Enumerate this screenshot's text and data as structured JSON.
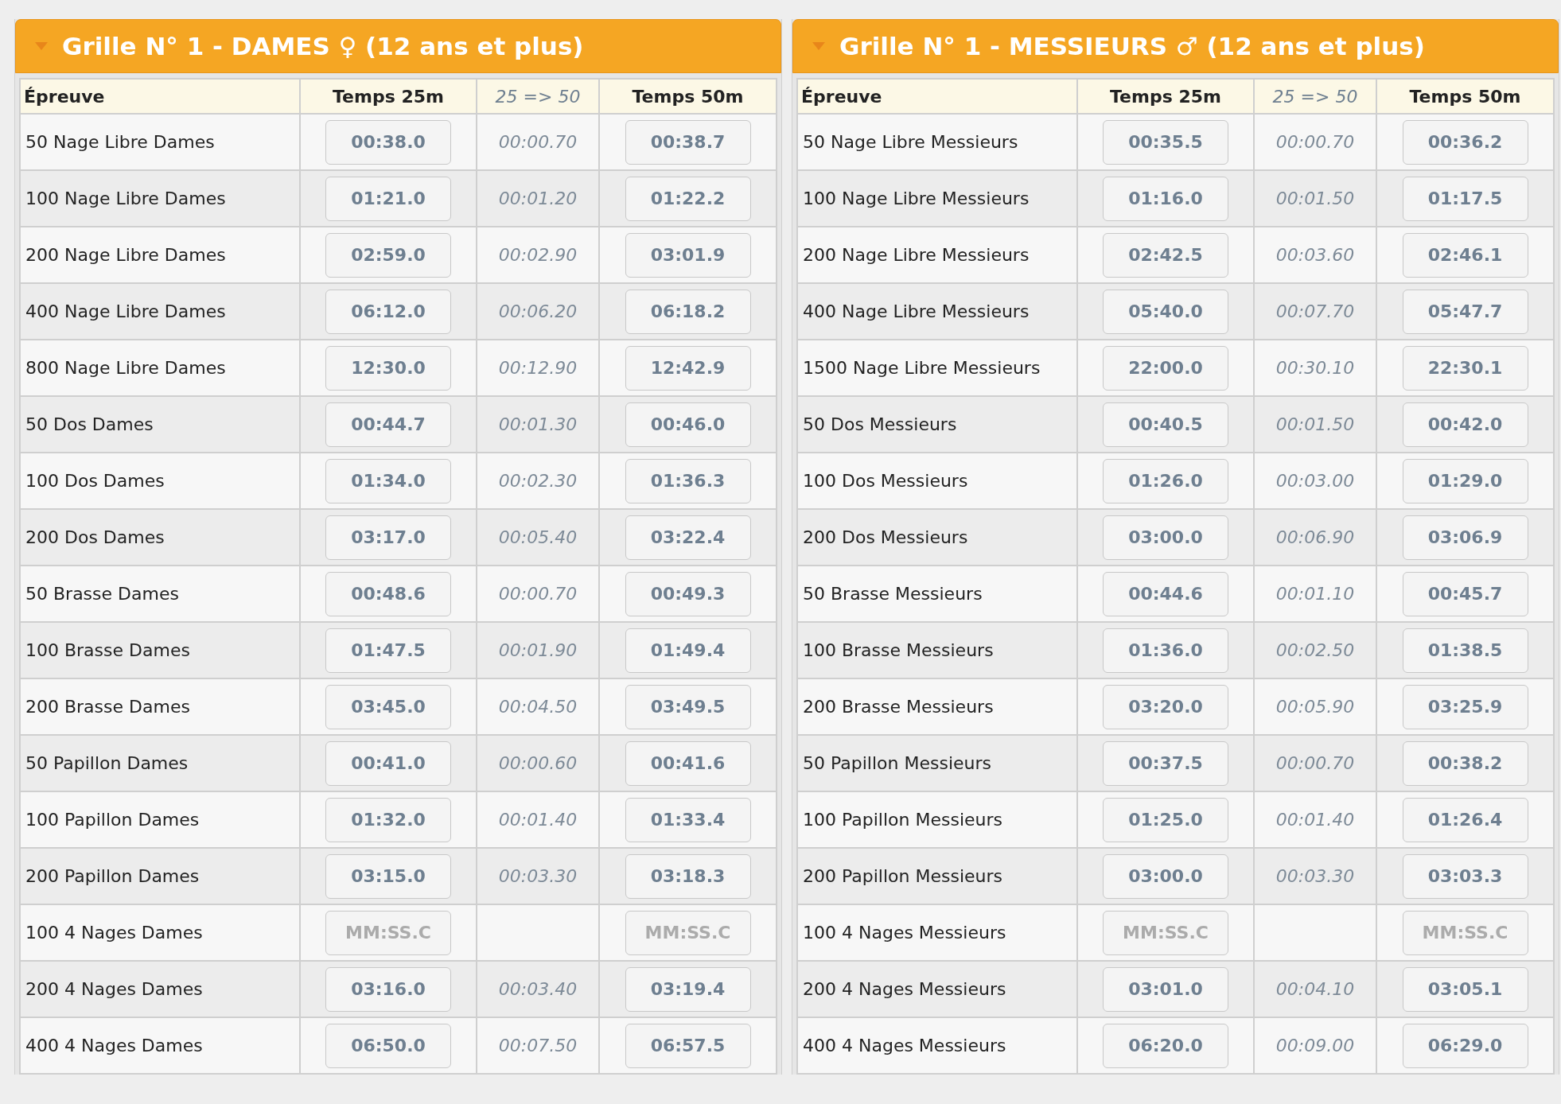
{
  "panels": [
    {
      "title": "Grille N° 1 - DAMES ♀ (12 ans et plus)",
      "columns": [
        "Épreuve",
        "Temps 25m",
        "25 => 50",
        "Temps 50m"
      ],
      "rows": [
        {
          "event": "50 Nage Libre Dames",
          "time_25m": {
            "value": "00:38.0"
          },
          "diff": "00:00.70",
          "time_50m": {
            "value": "00:38.7"
          }
        },
        {
          "event": "100 Nage Libre Dames",
          "time_25m": {
            "value": "01:21.0"
          },
          "diff": "00:01.20",
          "time_50m": {
            "value": "01:22.2"
          }
        },
        {
          "event": "200 Nage Libre Dames",
          "time_25m": {
            "value": "02:59.0"
          },
          "diff": "00:02.90",
          "time_50m": {
            "value": "03:01.9"
          }
        },
        {
          "event": "400 Nage Libre Dames",
          "time_25m": {
            "value": "06:12.0"
          },
          "diff": "00:06.20",
          "time_50m": {
            "value": "06:18.2"
          }
        },
        {
          "event": "800 Nage Libre Dames",
          "time_25m": {
            "value": "12:30.0"
          },
          "diff": "00:12.90",
          "time_50m": {
            "value": "12:42.9"
          }
        },
        {
          "event": "50 Dos Dames",
          "time_25m": {
            "value": "00:44.7"
          },
          "diff": "00:01.30",
          "time_50m": {
            "value": "00:46.0"
          }
        },
        {
          "event": "100 Dos Dames",
          "time_25m": {
            "value": "01:34.0"
          },
          "diff": "00:02.30",
          "time_50m": {
            "value": "01:36.3"
          }
        },
        {
          "event": "200 Dos Dames",
          "time_25m": {
            "value": "03:17.0"
          },
          "diff": "00:05.40",
          "time_50m": {
            "value": "03:22.4"
          }
        },
        {
          "event": "50 Brasse Dames",
          "time_25m": {
            "value": "00:48.6"
          },
          "diff": "00:00.70",
          "time_50m": {
            "value": "00:49.3"
          }
        },
        {
          "event": "100 Brasse Dames",
          "time_25m": {
            "value": "01:47.5"
          },
          "diff": "00:01.90",
          "time_50m": {
            "value": "01:49.4"
          }
        },
        {
          "event": "200 Brasse Dames",
          "time_25m": {
            "value": "03:45.0"
          },
          "diff": "00:04.50",
          "time_50m": {
            "value": "03:49.5"
          }
        },
        {
          "event": "50 Papillon Dames",
          "time_25m": {
            "value": "00:41.0"
          },
          "diff": "00:00.60",
          "time_50m": {
            "value": "00:41.6"
          }
        },
        {
          "event": "100 Papillon Dames",
          "time_25m": {
            "value": "01:32.0"
          },
          "diff": "00:01.40",
          "time_50m": {
            "value": "01:33.4"
          }
        },
        {
          "event": "200 Papillon Dames",
          "time_25m": {
            "value": "03:15.0"
          },
          "diff": "00:03.30",
          "time_50m": {
            "value": "03:18.3"
          }
        },
        {
          "event": "100 4 Nages Dames",
          "time_25m": {
            "placeholder": "MM:SS.C"
          },
          "time_50m": {
            "placeholder": "MM:SS.C"
          }
        },
        {
          "event": "200 4 Nages Dames",
          "time_25m": {
            "value": "03:16.0"
          },
          "diff": "00:03.40",
          "time_50m": {
            "value": "03:19.4"
          }
        },
        {
          "event": "400 4 Nages Dames",
          "time_25m": {
            "value": "06:50.0"
          },
          "diff": "00:07.50",
          "time_50m": {
            "value": "06:57.5"
          }
        }
      ]
    },
    {
      "title": "Grille N° 1 - MESSIEURS ♂ (12 ans et plus)",
      "columns": [
        "Épreuve",
        "Temps 25m",
        "25 => 50",
        "Temps 50m"
      ],
      "rows": [
        {
          "event": "50 Nage Libre Messieurs",
          "time_25m": {
            "value": "00:35.5"
          },
          "diff": "00:00.70",
          "time_50m": {
            "value": "00:36.2"
          }
        },
        {
          "event": "100 Nage Libre Messieurs",
          "time_25m": {
            "value": "01:16.0"
          },
          "diff": "00:01.50",
          "time_50m": {
            "value": "01:17.5"
          }
        },
        {
          "event": "200 Nage Libre Messieurs",
          "time_25m": {
            "value": "02:42.5"
          },
          "diff": "00:03.60",
          "time_50m": {
            "value": "02:46.1"
          }
        },
        {
          "event": "400 Nage Libre Messieurs",
          "time_25m": {
            "value": "05:40.0"
          },
          "diff": "00:07.70",
          "time_50m": {
            "value": "05:47.7"
          }
        },
        {
          "event": "1500 Nage Libre Messieurs",
          "time_25m": {
            "value": "22:00.0"
          },
          "diff": "00:30.10",
          "time_50m": {
            "value": "22:30.1"
          }
        },
        {
          "event": "50 Dos Messieurs",
          "time_25m": {
            "value": "00:40.5"
          },
          "diff": "00:01.50",
          "time_50m": {
            "value": "00:42.0"
          }
        },
        {
          "event": "100 Dos Messieurs",
          "time_25m": {
            "value": "01:26.0"
          },
          "diff": "00:03.00",
          "time_50m": {
            "value": "01:29.0"
          }
        },
        {
          "event": "200 Dos Messieurs",
          "time_25m": {
            "value": "03:00.0"
          },
          "diff": "00:06.90",
          "time_50m": {
            "value": "03:06.9"
          }
        },
        {
          "event": "50 Brasse Messieurs",
          "time_25m": {
            "value": "00:44.6"
          },
          "diff": "00:01.10",
          "time_50m": {
            "value": "00:45.7"
          }
        },
        {
          "event": "100 Brasse Messieurs",
          "time_25m": {
            "value": "01:36.0"
          },
          "diff": "00:02.50",
          "time_50m": {
            "value": "01:38.5"
          }
        },
        {
          "event": "200 Brasse Messieurs",
          "time_25m": {
            "value": "03:20.0"
          },
          "diff": "00:05.90",
          "time_50m": {
            "value": "03:25.9"
          }
        },
        {
          "event": "50 Papillon Messieurs",
          "time_25m": {
            "value": "00:37.5"
          },
          "diff": "00:00.70",
          "time_50m": {
            "value": "00:38.2"
          }
        },
        {
          "event": "100 Papillon Messieurs",
          "time_25m": {
            "value": "01:25.0"
          },
          "diff": "00:01.40",
          "time_50m": {
            "value": "01:26.4"
          }
        },
        {
          "event": "200 Papillon Messieurs",
          "time_25m": {
            "value": "03:00.0"
          },
          "diff": "00:03.30",
          "time_50m": {
            "value": "03:03.3"
          }
        },
        {
          "event": "100 4 Nages Messieurs",
          "time_25m": {
            "placeholder": "MM:SS.C"
          },
          "time_50m": {
            "placeholder": "MM:SS.C"
          }
        },
        {
          "event": "200 4 Nages Messieurs",
          "time_25m": {
            "value": "03:01.0"
          },
          "diff": "00:04.10",
          "time_50m": {
            "value": "03:05.1"
          }
        },
        {
          "event": "400 4 Nages Messieurs",
          "time_25m": {
            "value": "06:20.0"
          },
          "diff": "00:09.00",
          "time_50m": {
            "value": "06:29.0"
          }
        }
      ]
    }
  ]
}
